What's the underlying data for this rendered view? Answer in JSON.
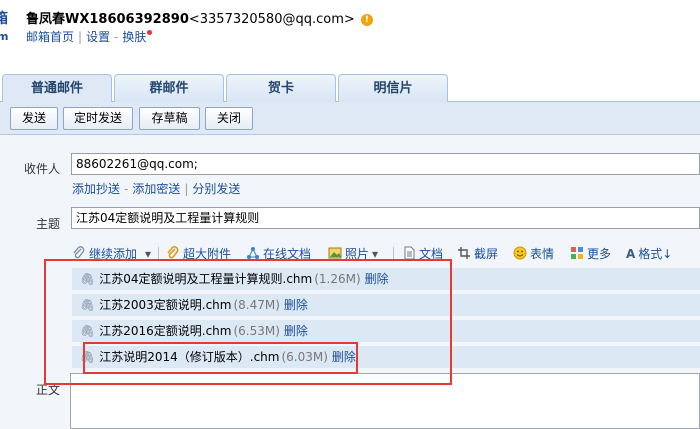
{
  "header": {
    "logo_fragment_top": "箱",
    "logo_fragment_bottom": "m",
    "account_name": "鲁凤春WX18606392890",
    "account_email": "<3357320580@qq.com>",
    "warn_symbol": "!",
    "links": [
      "邮箱首页",
      "设置",
      "换肤"
    ],
    "separator": "|",
    "dash": "-"
  },
  "tabs": [
    {
      "label": "普通邮件",
      "active": true
    },
    {
      "label": "群邮件",
      "active": false
    },
    {
      "label": "贺卡",
      "active": false
    },
    {
      "label": "明信片",
      "active": false
    }
  ],
  "toolbar": {
    "send": "发送",
    "scheduled_send": "定时发送",
    "save_draft": "存草稿",
    "close": "关闭"
  },
  "form": {
    "recipient_label": "收件人",
    "recipient_value": "88602261@qq.com;",
    "add_cc": "添加抄送",
    "add_bcc": "添加密送",
    "separate_send": "分别发送",
    "subject_label": "主题",
    "subject_value": "江苏04定额说明及工程量计算规则",
    "body_label": "正文"
  },
  "attach_toolbar": {
    "continue_add": "继续添加",
    "large_attachment": "超大附件",
    "online_doc": "在线文档",
    "photo": "照片",
    "document": "文档",
    "screenshot": "截屏",
    "emoji": "表情",
    "more": "更多",
    "format": "格式↓"
  },
  "attachments": [
    {
      "name": "江苏04定额说明及工程量计算规则.chm",
      "size": "(1.26M)",
      "delete": "删除"
    },
    {
      "name": "江苏2003定额说明.chm",
      "size": "(8.47M)",
      "delete": "删除"
    },
    {
      "name": "江苏2016定额说明.chm",
      "size": "(6.53M)",
      "delete": "删除"
    },
    {
      "name": "江苏说明2014（修订版本）.chm",
      "size": "(6.03M)",
      "delete": "删除"
    }
  ],
  "colors": {
    "link": "#1b4e9b",
    "highlight_box": "#e53935",
    "toolbar_bg": "#dfe9f6",
    "attachment_bg": "#dde8f5"
  }
}
